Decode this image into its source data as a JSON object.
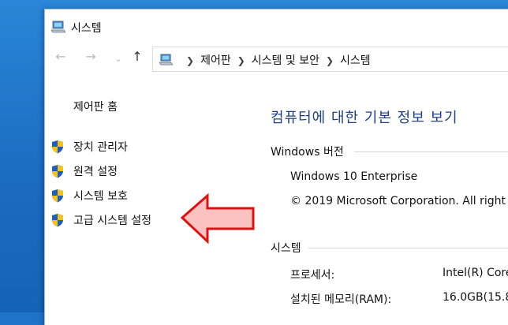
{
  "window": {
    "title": "시스템"
  },
  "address_bar": {
    "crumbs": [
      "제어판",
      "시스템 및 보안",
      "시스템"
    ]
  },
  "left_pane": {
    "home_link": "제어판 홈",
    "links": [
      "장치 관리자",
      "원격 설정",
      "시스템 보호",
      "고급 시스템 설정"
    ]
  },
  "main": {
    "title": "컴퓨터에 대한 기본 정보 보기",
    "windows_section": {
      "label": "Windows 버전",
      "edition": "Windows 10 Enterprise",
      "copyright": "© 2019 Microsoft Corporation. All right"
    },
    "system_section": {
      "label": "시스템",
      "processor_label": "프로세서:",
      "processor_value": "Intel(R) Core",
      "ram_label": "설치된 메모리(RAM):",
      "ram_value": "16.0GB(15.8"
    }
  },
  "icons": {
    "title": "computer-icon",
    "address": "computer-icon",
    "nav_back": "arrow-left-icon",
    "nav_forward": "arrow-right-icon",
    "nav_recent": "chevron-down-icon",
    "nav_up": "arrow-up-icon",
    "links": "uac-shield-icon"
  },
  "colors": {
    "desktop": "#1e74c8",
    "title_text": "#1f3f88",
    "arrow_fill": "#fbc2c2",
    "arrow_stroke": "#e01010"
  }
}
